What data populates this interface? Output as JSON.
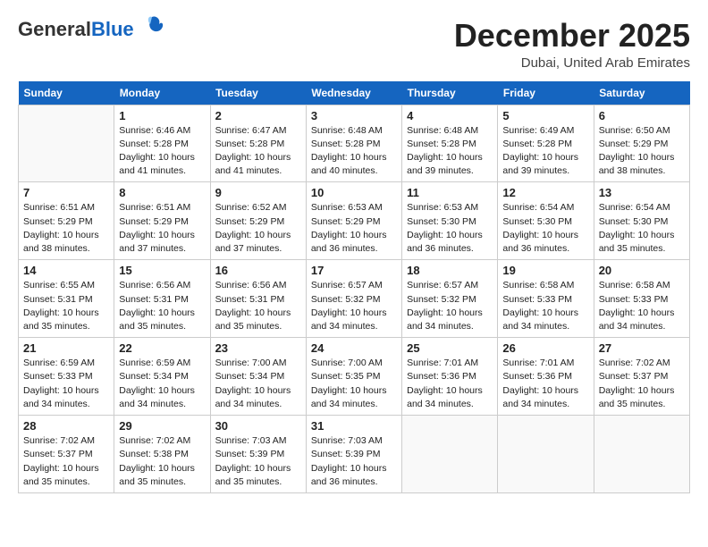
{
  "logo": {
    "general": "General",
    "blue": "Blue"
  },
  "title": {
    "month_year": "December 2025",
    "location": "Dubai, United Arab Emirates"
  },
  "weekdays": [
    "Sunday",
    "Monday",
    "Tuesday",
    "Wednesday",
    "Thursday",
    "Friday",
    "Saturday"
  ],
  "weeks": [
    [
      {
        "day": null
      },
      {
        "day": "1",
        "sunrise": "Sunrise: 6:46 AM",
        "sunset": "Sunset: 5:28 PM",
        "daylight": "Daylight: 10 hours and 41 minutes."
      },
      {
        "day": "2",
        "sunrise": "Sunrise: 6:47 AM",
        "sunset": "Sunset: 5:28 PM",
        "daylight": "Daylight: 10 hours and 41 minutes."
      },
      {
        "day": "3",
        "sunrise": "Sunrise: 6:48 AM",
        "sunset": "Sunset: 5:28 PM",
        "daylight": "Daylight: 10 hours and 40 minutes."
      },
      {
        "day": "4",
        "sunrise": "Sunrise: 6:48 AM",
        "sunset": "Sunset: 5:28 PM",
        "daylight": "Daylight: 10 hours and 39 minutes."
      },
      {
        "day": "5",
        "sunrise": "Sunrise: 6:49 AM",
        "sunset": "Sunset: 5:28 PM",
        "daylight": "Daylight: 10 hours and 39 minutes."
      },
      {
        "day": "6",
        "sunrise": "Sunrise: 6:50 AM",
        "sunset": "Sunset: 5:29 PM",
        "daylight": "Daylight: 10 hours and 38 minutes."
      }
    ],
    [
      {
        "day": "7",
        "sunrise": "Sunrise: 6:51 AM",
        "sunset": "Sunset: 5:29 PM",
        "daylight": "Daylight: 10 hours and 38 minutes."
      },
      {
        "day": "8",
        "sunrise": "Sunrise: 6:51 AM",
        "sunset": "Sunset: 5:29 PM",
        "daylight": "Daylight: 10 hours and 37 minutes."
      },
      {
        "day": "9",
        "sunrise": "Sunrise: 6:52 AM",
        "sunset": "Sunset: 5:29 PM",
        "daylight": "Daylight: 10 hours and 37 minutes."
      },
      {
        "day": "10",
        "sunrise": "Sunrise: 6:53 AM",
        "sunset": "Sunset: 5:29 PM",
        "daylight": "Daylight: 10 hours and 36 minutes."
      },
      {
        "day": "11",
        "sunrise": "Sunrise: 6:53 AM",
        "sunset": "Sunset: 5:30 PM",
        "daylight": "Daylight: 10 hours and 36 minutes."
      },
      {
        "day": "12",
        "sunrise": "Sunrise: 6:54 AM",
        "sunset": "Sunset: 5:30 PM",
        "daylight": "Daylight: 10 hours and 36 minutes."
      },
      {
        "day": "13",
        "sunrise": "Sunrise: 6:54 AM",
        "sunset": "Sunset: 5:30 PM",
        "daylight": "Daylight: 10 hours and 35 minutes."
      }
    ],
    [
      {
        "day": "14",
        "sunrise": "Sunrise: 6:55 AM",
        "sunset": "Sunset: 5:31 PM",
        "daylight": "Daylight: 10 hours and 35 minutes."
      },
      {
        "day": "15",
        "sunrise": "Sunrise: 6:56 AM",
        "sunset": "Sunset: 5:31 PM",
        "daylight": "Daylight: 10 hours and 35 minutes."
      },
      {
        "day": "16",
        "sunrise": "Sunrise: 6:56 AM",
        "sunset": "Sunset: 5:31 PM",
        "daylight": "Daylight: 10 hours and 35 minutes."
      },
      {
        "day": "17",
        "sunrise": "Sunrise: 6:57 AM",
        "sunset": "Sunset: 5:32 PM",
        "daylight": "Daylight: 10 hours and 34 minutes."
      },
      {
        "day": "18",
        "sunrise": "Sunrise: 6:57 AM",
        "sunset": "Sunset: 5:32 PM",
        "daylight": "Daylight: 10 hours and 34 minutes."
      },
      {
        "day": "19",
        "sunrise": "Sunrise: 6:58 AM",
        "sunset": "Sunset: 5:33 PM",
        "daylight": "Daylight: 10 hours and 34 minutes."
      },
      {
        "day": "20",
        "sunrise": "Sunrise: 6:58 AM",
        "sunset": "Sunset: 5:33 PM",
        "daylight": "Daylight: 10 hours and 34 minutes."
      }
    ],
    [
      {
        "day": "21",
        "sunrise": "Sunrise: 6:59 AM",
        "sunset": "Sunset: 5:33 PM",
        "daylight": "Daylight: 10 hours and 34 minutes."
      },
      {
        "day": "22",
        "sunrise": "Sunrise: 6:59 AM",
        "sunset": "Sunset: 5:34 PM",
        "daylight": "Daylight: 10 hours and 34 minutes."
      },
      {
        "day": "23",
        "sunrise": "Sunrise: 7:00 AM",
        "sunset": "Sunset: 5:34 PM",
        "daylight": "Daylight: 10 hours and 34 minutes."
      },
      {
        "day": "24",
        "sunrise": "Sunrise: 7:00 AM",
        "sunset": "Sunset: 5:35 PM",
        "daylight": "Daylight: 10 hours and 34 minutes."
      },
      {
        "day": "25",
        "sunrise": "Sunrise: 7:01 AM",
        "sunset": "Sunset: 5:36 PM",
        "daylight": "Daylight: 10 hours and 34 minutes."
      },
      {
        "day": "26",
        "sunrise": "Sunrise: 7:01 AM",
        "sunset": "Sunset: 5:36 PM",
        "daylight": "Daylight: 10 hours and 34 minutes."
      },
      {
        "day": "27",
        "sunrise": "Sunrise: 7:02 AM",
        "sunset": "Sunset: 5:37 PM",
        "daylight": "Daylight: 10 hours and 35 minutes."
      }
    ],
    [
      {
        "day": "28",
        "sunrise": "Sunrise: 7:02 AM",
        "sunset": "Sunset: 5:37 PM",
        "daylight": "Daylight: 10 hours and 35 minutes."
      },
      {
        "day": "29",
        "sunrise": "Sunrise: 7:02 AM",
        "sunset": "Sunset: 5:38 PM",
        "daylight": "Daylight: 10 hours and 35 minutes."
      },
      {
        "day": "30",
        "sunrise": "Sunrise: 7:03 AM",
        "sunset": "Sunset: 5:39 PM",
        "daylight": "Daylight: 10 hours and 35 minutes."
      },
      {
        "day": "31",
        "sunrise": "Sunrise: 7:03 AM",
        "sunset": "Sunset: 5:39 PM",
        "daylight": "Daylight: 10 hours and 36 minutes."
      },
      {
        "day": null
      },
      {
        "day": null
      },
      {
        "day": null
      }
    ]
  ]
}
